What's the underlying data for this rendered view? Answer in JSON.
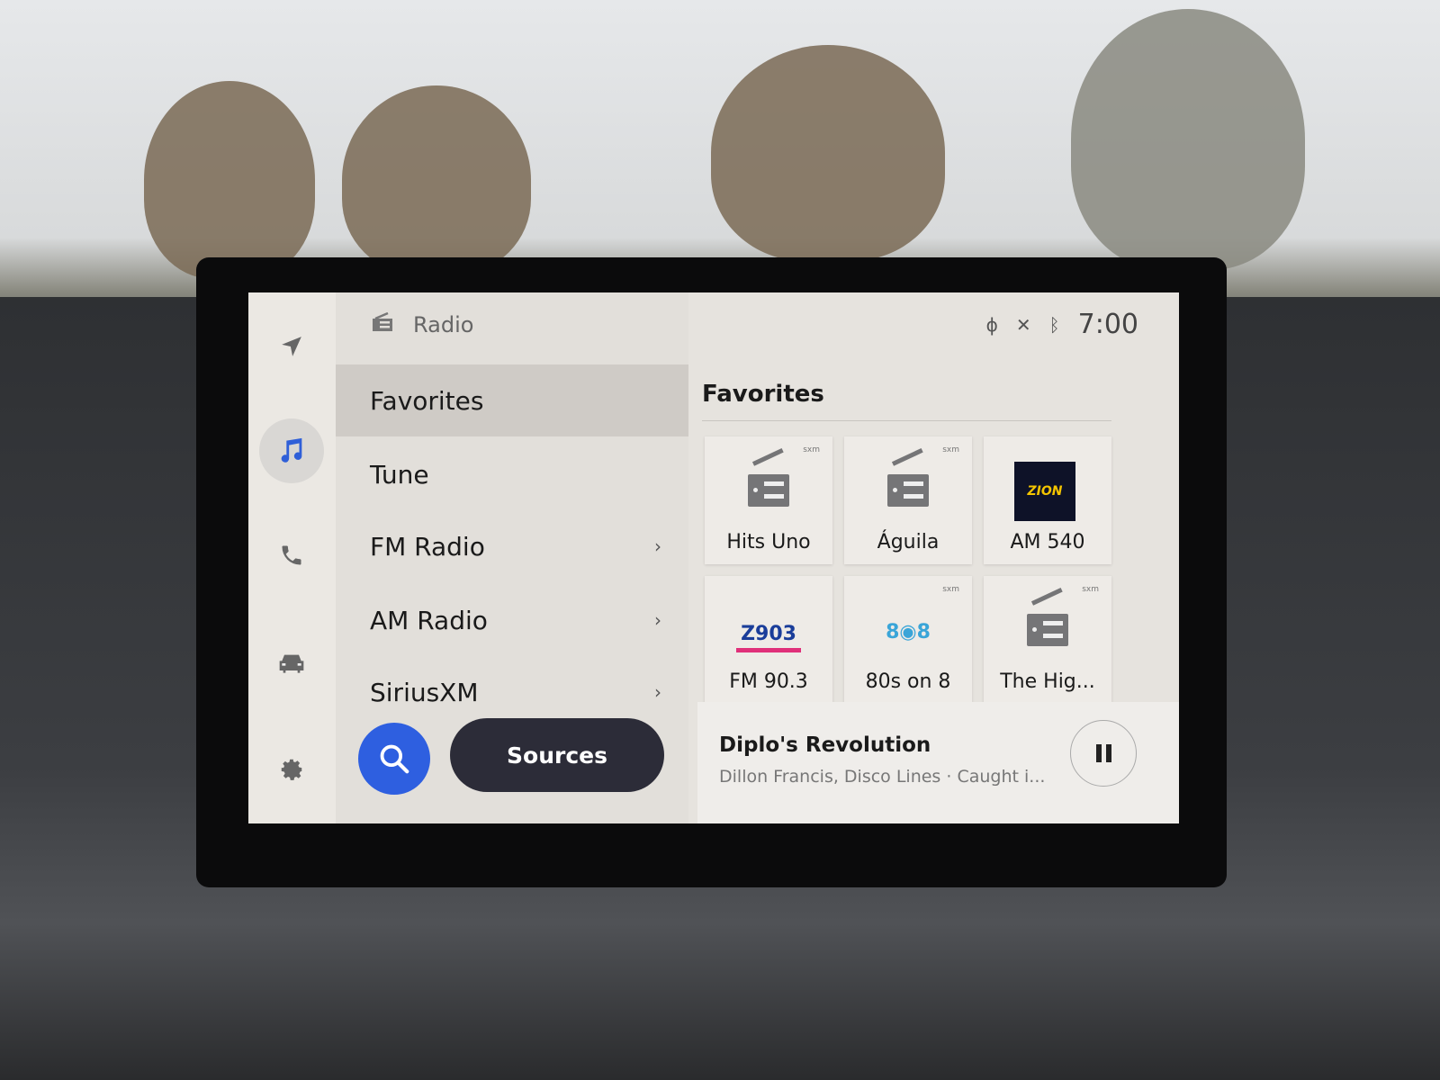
{
  "colors": {
    "accent": "#2e5fe0",
    "sources_button": "#2c2c38",
    "active_nav_icon": "#2f5fd8"
  },
  "rail": {
    "items": [
      {
        "icon": "navigation-arrow-icon"
      },
      {
        "icon": "music-note-icon",
        "active": true
      },
      {
        "icon": "phone-icon"
      },
      {
        "icon": "car-icon"
      },
      {
        "icon": "gear-icon"
      }
    ]
  },
  "menu": {
    "header": {
      "icon": "radio-icon",
      "title": "Radio"
    },
    "items": [
      {
        "label": "Favorites",
        "selected": true,
        "chevron": false
      },
      {
        "label": "Tune",
        "chevron": false
      },
      {
        "label": "FM Radio",
        "chevron": true
      },
      {
        "label": "AM Radio",
        "chevron": true
      },
      {
        "label": "SiriusXM",
        "chevron": true
      }
    ],
    "chevron": "›",
    "search_icon": "search-icon",
    "sources_label": "Sources"
  },
  "status": {
    "icons": [
      "wireless-charging-icon",
      "voice-muted-icon",
      "bluetooth-icon"
    ],
    "time": "7:00"
  },
  "favorites": {
    "title": "Favorites",
    "tiles": [
      {
        "label": "Hits Uno",
        "art": "radio-icon",
        "sxm": true
      },
      {
        "label": "Águila",
        "art": "radio-icon",
        "sxm": true
      },
      {
        "label": "AM 540",
        "art": "radio-zion-logo",
        "logo_text": "ZION",
        "sxm": false
      },
      {
        "label": "FM 90.3",
        "art": "z903-logo",
        "logo_text": "Z903",
        "sxm": false
      },
      {
        "label": "80s on 8",
        "art": "80s-on-8-logo",
        "logo_text": "8◉8",
        "sxm": true
      },
      {
        "label": "The Hig...",
        "art": "radio-icon",
        "sxm": true
      }
    ],
    "sxm_badge": "sxm"
  },
  "now_playing": {
    "title": "Diplo's Revolution",
    "subtitle": "Dillon Francis, Disco Lines · Caught i...",
    "state": "playing",
    "control": "pause-icon"
  }
}
